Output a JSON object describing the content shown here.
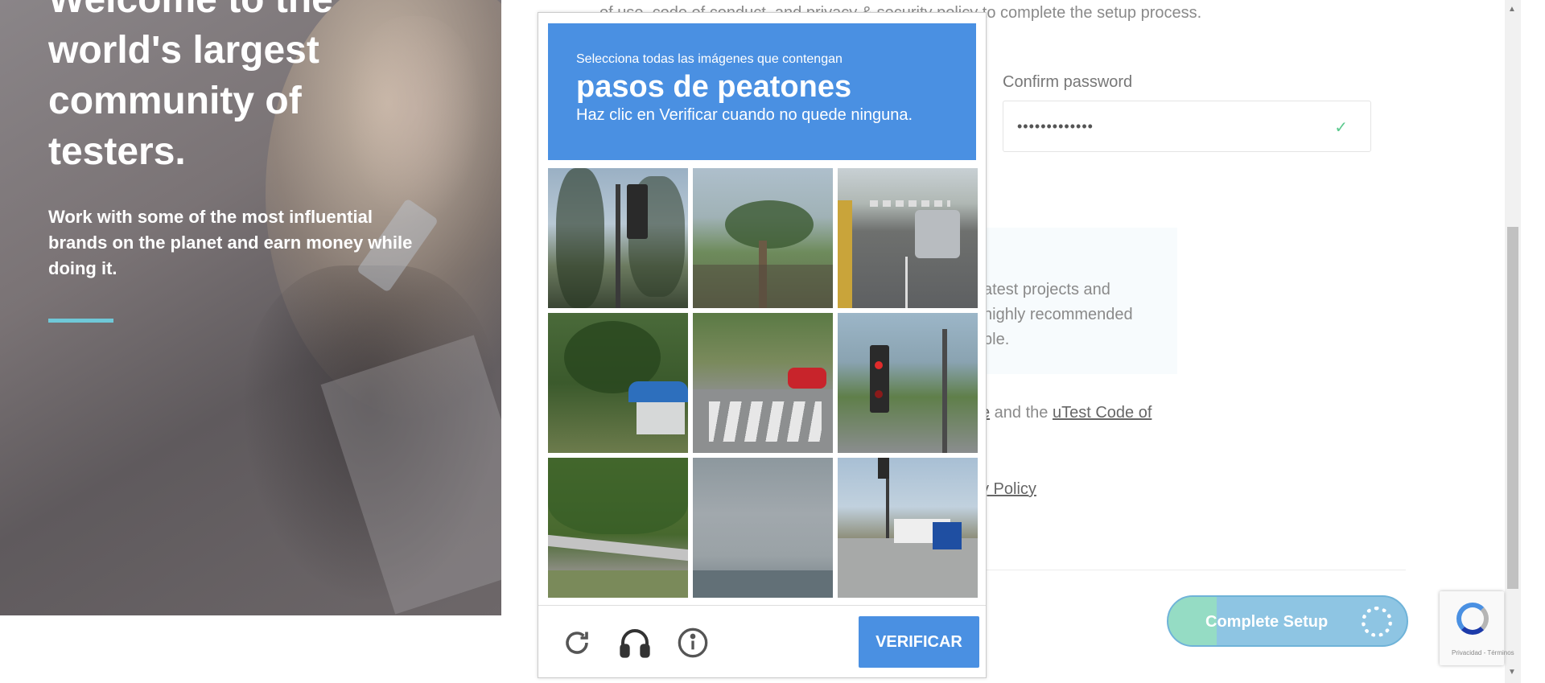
{
  "hero": {
    "title": "Welcome to the\nworld's largest\ncommunity of\ntesters.",
    "subtitle": "Work with some of the most influential brands on the planet and earn money while doing it."
  },
  "form": {
    "top_text": "of use, code of conduct, and privacy & security policy to complete the setup process.",
    "confirm_password_label": "Confirm password",
    "confirm_password_value": "•••••••••••••",
    "info_line1": "atest projects and",
    "info_line2": "highly recommended",
    "info_line3": "ble.",
    "terms_prefix": "e",
    "terms_mid": " and the ",
    "terms_link": "uTest Code of",
    "privacy_link": "y Policy",
    "complete_button": "Complete Setup"
  },
  "captcha": {
    "instruction": "Selecciona todas las imágenes que contengan",
    "target": "pasos de peatones",
    "hint": "Haz clic en Verificar cuando no quede ninguna.",
    "verify_button": "VERIFICAR",
    "icons": [
      "reload-icon",
      "headphones-icon",
      "info-icon"
    ],
    "tiles": [
      "traffic-light-trees",
      "palm-tree",
      "street-car-crosswalk",
      "palm-trees-building",
      "crosswalk-red-car",
      "traffic-light-road",
      "trees-guardrail",
      "cloudy-sky",
      "intersection-truck"
    ]
  },
  "recaptcha_badge": {
    "text": "Privacidad - Términos"
  },
  "colors": {
    "captcha_blue": "#4a90e2",
    "check_green": "#5cc98e",
    "hero_accent": "#6fc8d8"
  }
}
